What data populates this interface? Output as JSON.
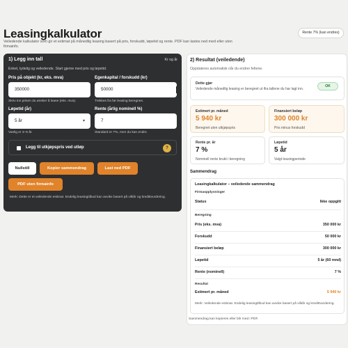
{
  "header": {
    "title": "Leasingkalkulator",
    "subtitle": "Veiledende kalkulator som gir et estimat på månedlig leasing basert på pris, forskudd, løpetid og rente. PDF kan lastes ned med eller uten firmainfo.",
    "rate_pill": "Rente 7% (kan endres)"
  },
  "input_panel": {
    "title": "1) Legg inn tall",
    "hint_right": "Kr og år",
    "subtitle": "Enkel, tydelig og veiledende. Start gjerne med pris og løpetid.",
    "price": {
      "label": "Pris på objekt (kr, eks. mva)",
      "value": "350000",
      "hint": "Skriv inn prisen du ønsker å lease (eks. mva)."
    },
    "down_payment": {
      "label": "Egenkapital / forskudd (kr)",
      "value": "50000",
      "hint": "Trekkes fra før leasing beregnes."
    },
    "term": {
      "label": "Løpetid (år)",
      "value": "5 år",
      "hint": "Vanlig er 3–5 år."
    },
    "rate": {
      "label": "Rente (årlig nominell %)",
      "value": "7",
      "hint": "Standard er 7%, men du kan endre."
    },
    "residual_checkbox": {
      "label": "Legg til utkjøpspris ved utløp",
      "checked": false,
      "help": "?"
    },
    "buttons": {
      "reset": "Nullstill",
      "copy": "Kopier sammendrag",
      "download_pdf": "Last ned PDF",
      "pdf_no_company": "PDF uten firmainfo"
    },
    "note": "Merk: Dette er et veiledende estimat. Endelig leasingtilbud kan avvike basert på vilkår og kredittvurdering."
  },
  "result_panel": {
    "title": "2) Resultat (veiledende)",
    "subtitle": "Oppdateres automatisk når du endrer feltene.",
    "status_card": {
      "label": "Dette gjør",
      "text": "Veiledende månedlig leasing er beregnet ut ifra tallene du har lagt inn.",
      "badge": "OK",
      "badge_color": "#207a32"
    },
    "monthly": {
      "label": "Estimert pr. måned",
      "value": "5 940 kr",
      "note": "Beregnet uten utkjøpspris"
    },
    "financed": {
      "label": "Finansiert beløp",
      "value": "300 000 kr",
      "note": "Pris minus forskudd"
    },
    "rate": {
      "label": "Rente pr. år",
      "value": "7 %",
      "note": "Nominell rente brukt i beregning"
    },
    "term": {
      "label": "Løpetid",
      "value": "5 år",
      "note": "Valgt leasingperiode"
    },
    "summary": {
      "heading": "Sammendrag",
      "title": "Leasingkalkulator – veiledende sammendrag",
      "company_group": "Firmaopplysninger",
      "status": {
        "k": "Status",
        "v": "Ikke oppgitt"
      },
      "calc_group": "Beregning",
      "rows": [
        {
          "k": "Pris (eks. mva)",
          "v": "350 000 kr"
        },
        {
          "k": "Forskudd",
          "v": "50 000 kr"
        },
        {
          "k": "Finansiert beløp",
          "v": "300 000 kr"
        },
        {
          "k": "Løpetid",
          "v": "5 år (60 mnd)"
        },
        {
          "k": "Rente (nominell)",
          "v": "7 %"
        }
      ],
      "result_group": "Resultat",
      "result": {
        "k": "Estimert pr. måned",
        "v": "5 940 kr"
      },
      "note": "Merk: Veiledende estimat. Endelig leasingtilbud kan avvike basert på vilkår og kredittvurdering."
    },
    "footer_note": "Sammendrag kan kopieres eller blir med i PDF."
  },
  "colors": {
    "accent": "#e0832a",
    "dark_panel": "#2e2f31",
    "ok_green": "#207a32"
  }
}
